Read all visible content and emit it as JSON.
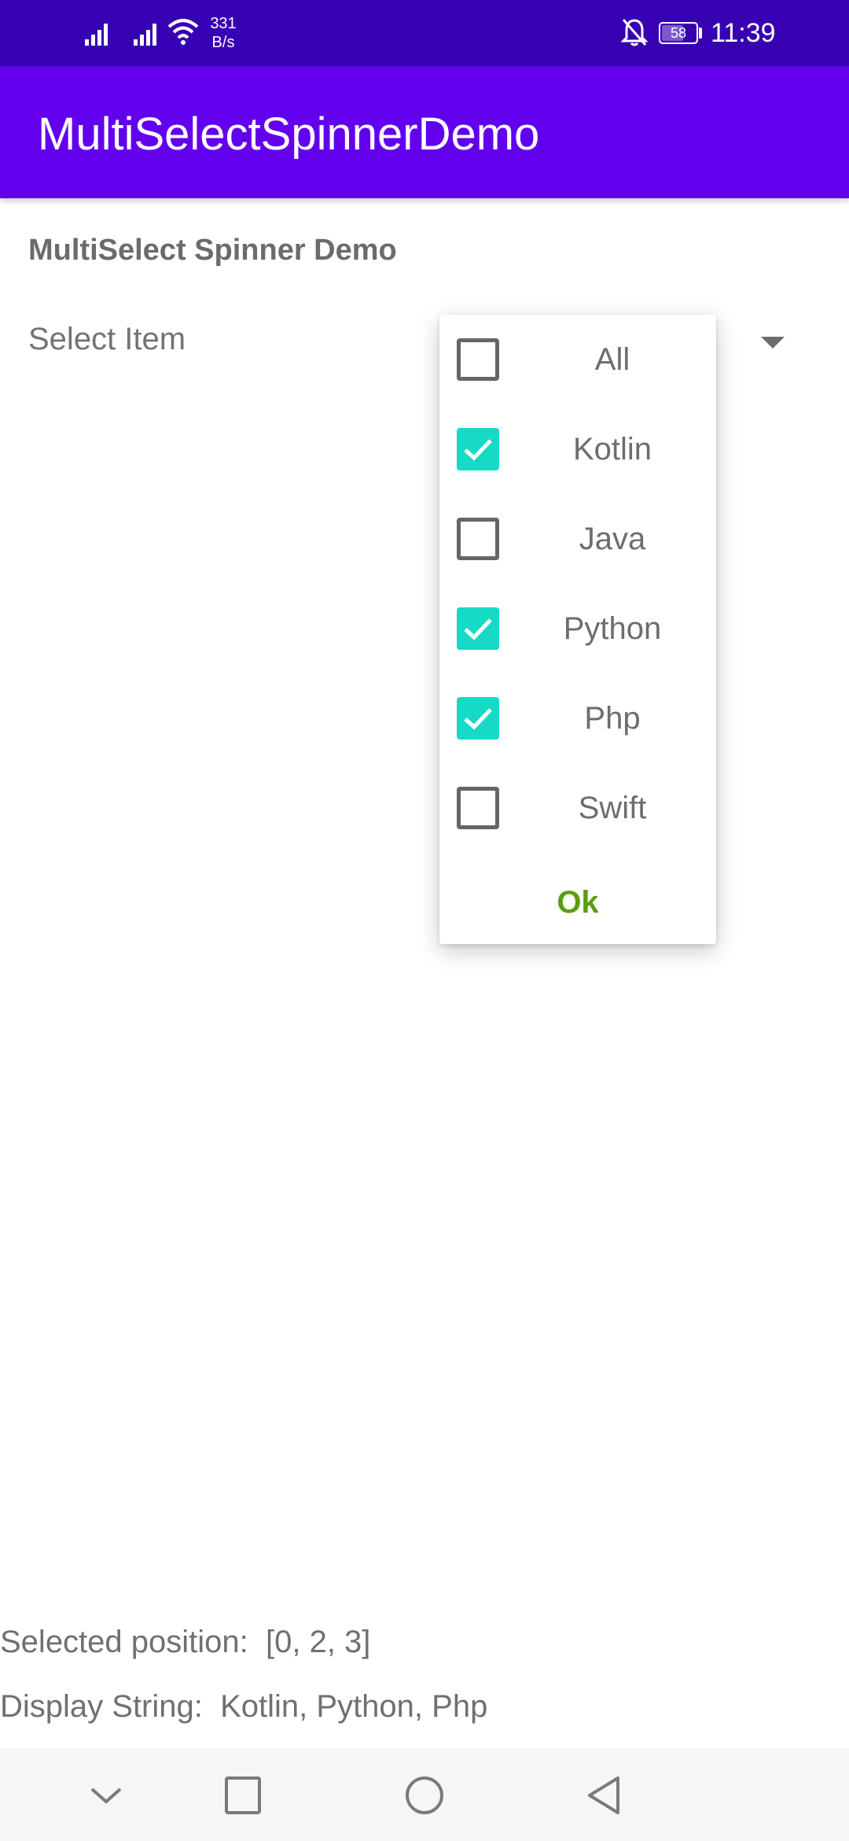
{
  "status_bar": {
    "net_speed_value": "331",
    "net_speed_unit": "B/s",
    "battery": "58",
    "time": "11:39"
  },
  "app_bar": {
    "title": "MultiSelectSpinnerDemo"
  },
  "page": {
    "heading": "MultiSelect Spinner Demo"
  },
  "spinner": {
    "label": "Select Item"
  },
  "dropdown": {
    "options": [
      {
        "label": "All",
        "checked": false
      },
      {
        "label": "Kotlin",
        "checked": true
      },
      {
        "label": "Java",
        "checked": false
      },
      {
        "label": "Python",
        "checked": true
      },
      {
        "label": "Php",
        "checked": true
      },
      {
        "label": "Swift",
        "checked": false
      }
    ],
    "ok_label": "Ok"
  },
  "results": {
    "selected_position": "Selected position:  [0, 2, 3]",
    "display_string": "Display String:  Kotlin, Python, Php"
  },
  "colors": {
    "status_bar": "#3700b3",
    "app_bar": "#6200ee",
    "checkbox_checked": "#16d9c6",
    "ok_text": "#5a9e0f"
  }
}
